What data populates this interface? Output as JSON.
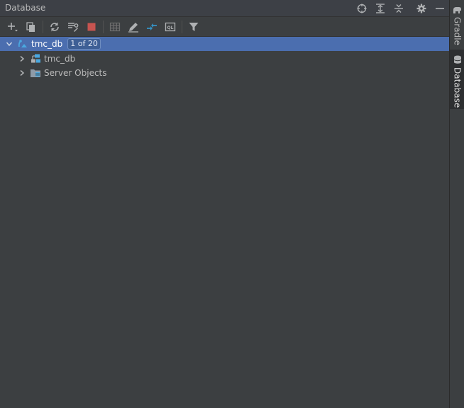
{
  "window": {
    "title": "Database"
  },
  "title_actions": [
    "target-icon",
    "expand-all-icon",
    "collapse-all-icon",
    "gear-icon",
    "minimize-icon"
  ],
  "toolbar": {
    "buttons": [
      "add-icon",
      "copy-icon",
      "refresh-icon",
      "properties-icon",
      "stop-icon",
      "table-icon",
      "edit-icon",
      "jump-icon",
      "sql-console-icon",
      "filter-icon"
    ]
  },
  "tree": {
    "root": {
      "label": "tmc_db",
      "badge": "1 of 20"
    },
    "children": [
      {
        "label": "tmc_db"
      },
      {
        "label": "Server Objects"
      }
    ]
  },
  "side_tabs": [
    {
      "label": "Gradle"
    },
    {
      "label": "Database"
    }
  ],
  "colors": {
    "selection": "#4b6eaf",
    "stop_red": "#c75450",
    "accent_blue": "#3592c4"
  }
}
